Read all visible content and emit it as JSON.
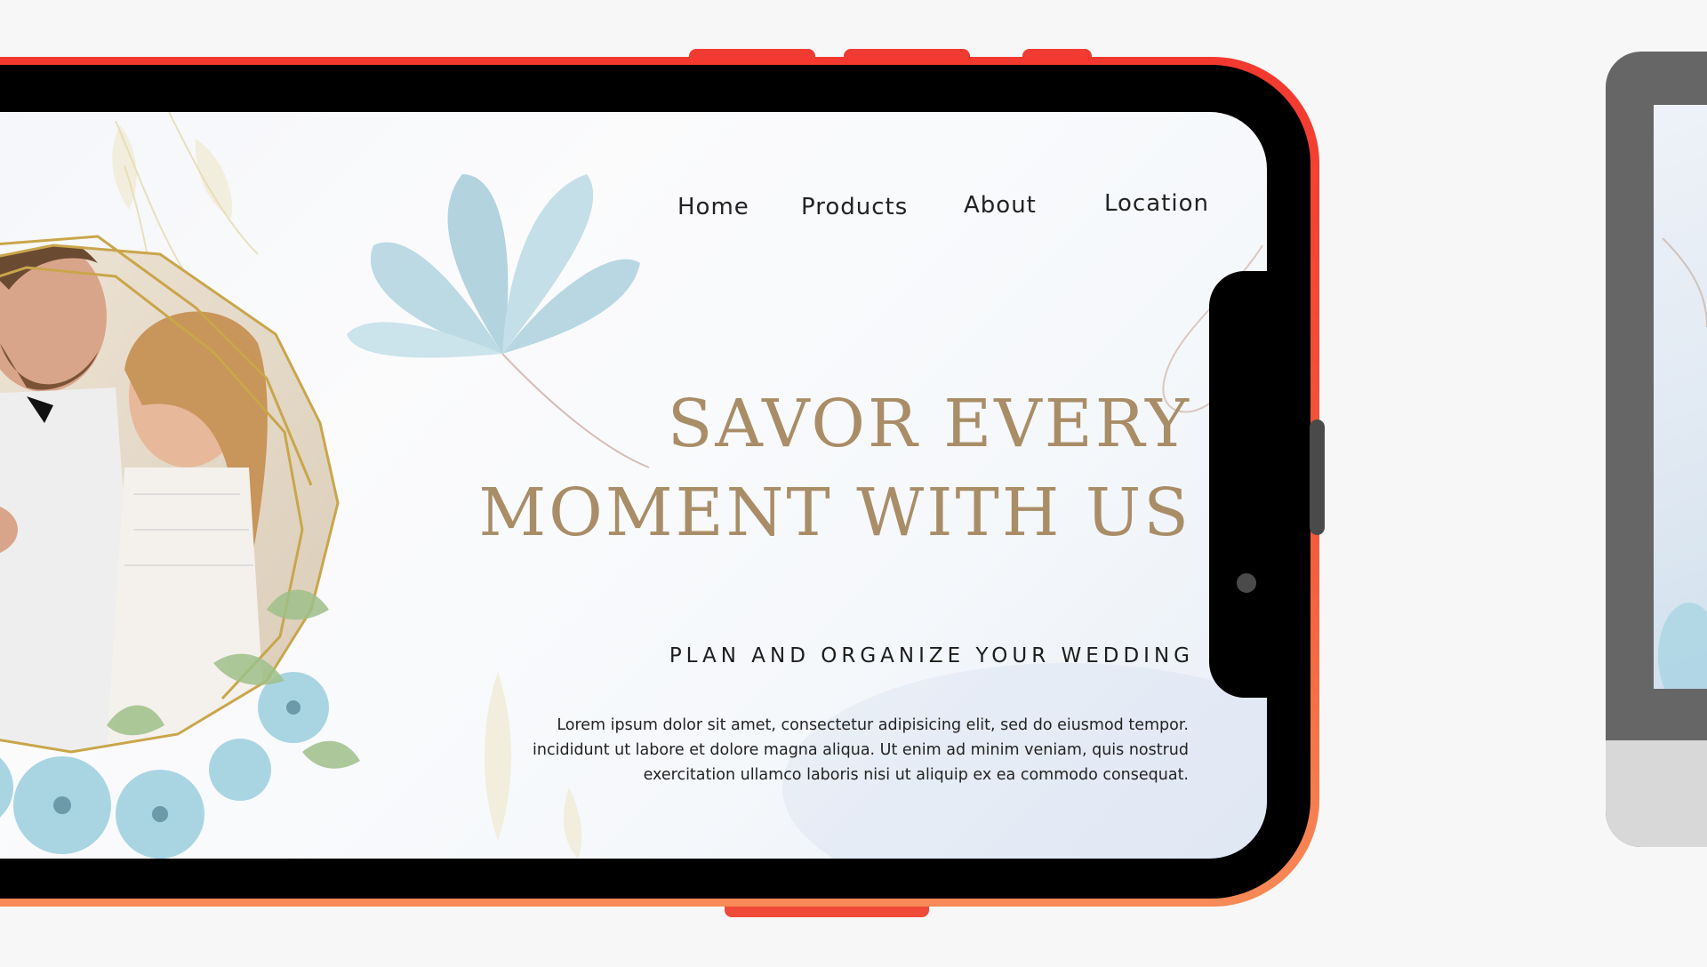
{
  "nav": {
    "home": "Home",
    "products": "Products",
    "about": "About",
    "location": "Location"
  },
  "hero": {
    "headline_line1": "SAVOR EVERY",
    "headline_line2": "MOMENT WITH US",
    "subheading": "PLAN AND ORGANIZE YOUR WEDDING",
    "body_line1": "Lorem ipsum dolor sit amet, consectetur adipisicing elit, sed do eiusmod tempor.",
    "body_line2": "incididunt ut labore et dolore magna aliqua. Ut enim ad minim veniam, quis nostrud",
    "body_line3": "exercitation ullamco laboris nisi ut aliquip ex ea commodo consequat."
  },
  "colors": {
    "phone_frame": "#f3392f",
    "headline_gold": "#a98d67",
    "frame_gold": "#c9a64a",
    "flower_blue": "#a9cfd9"
  },
  "icons": {
    "hero_image": "couple-photo-with-geometric-gold-frame",
    "flower": "watercolor-blue-flower"
  }
}
